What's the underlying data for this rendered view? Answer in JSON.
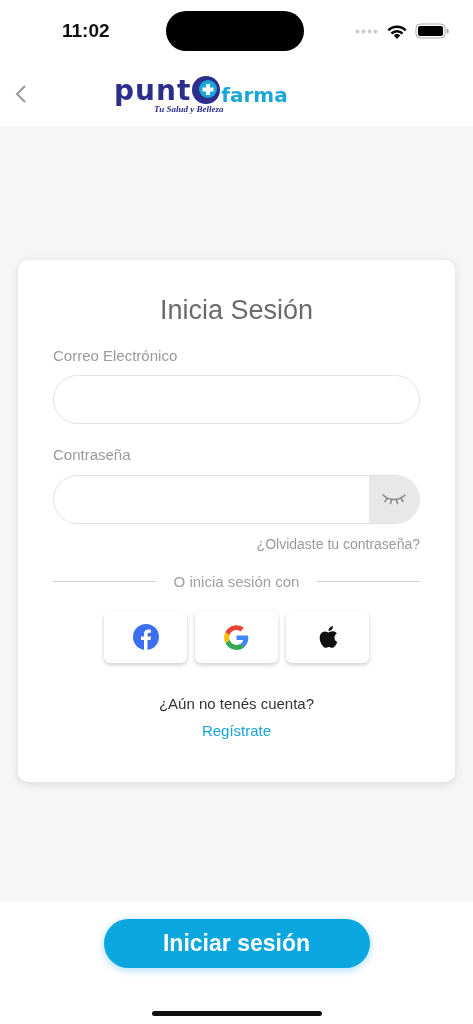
{
  "status_bar": {
    "time": "11:02"
  },
  "header": {
    "logo": {
      "left": "punt",
      "right": "farma",
      "tagline": "Tu Salud y Belleza"
    }
  },
  "login_card": {
    "title": "Inicia Sesión",
    "fields": [
      {
        "kind": "email",
        "label": "Correo Electrónico"
      },
      {
        "kind": "password",
        "label": "Contraseña"
      }
    ],
    "forgot_link": "¿Olvidaste tu contraseña?",
    "divider_text": "O inicia sesión con",
    "social_buttons": [
      {
        "kind": "facebook"
      },
      {
        "kind": "google"
      },
      {
        "kind": "apple"
      }
    ],
    "signup_prompt": "¿Aún no tenés cuenta?",
    "signup_link": "Regístrate"
  },
  "submit_button": "Iniciar sesión"
}
